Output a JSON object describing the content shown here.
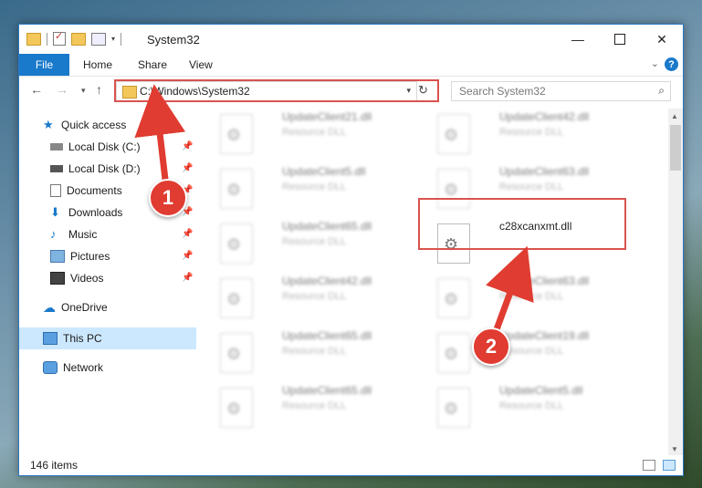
{
  "window": {
    "title": "System32",
    "minimize": "—",
    "close": "✕"
  },
  "ribbon": {
    "tabs": [
      "File",
      "Home",
      "Share",
      "View"
    ],
    "help": "?"
  },
  "address": {
    "path": "C:\\Windows\\System32",
    "search_placeholder": "Search System32"
  },
  "navpane": {
    "quick_access": "Quick access",
    "items": [
      "Local Disk (C:)",
      "Local Disk (D:)",
      "Documents",
      "Downloads",
      "Music",
      "Pictures",
      "Videos"
    ],
    "onedrive": "OneDrive",
    "this_pc": "This PC",
    "network": "Network"
  },
  "files": [
    {
      "name": "UpdateClient21.dll",
      "type": "Resource DLL"
    },
    {
      "name": "UpdateClient42.dll",
      "type": "Resource DLL"
    },
    {
      "name": "UpdateClient5.dll",
      "type": "Resource DLL"
    },
    {
      "name": "UpdateClient63.dll",
      "type": "Resource DLL"
    },
    {
      "name": "UpdateClient65.dll",
      "type": "Resource DLL"
    },
    {
      "name": "c28xcanxmt.dll",
      "type": ""
    },
    {
      "name": "UpdateClient42.dll",
      "type": "Resource DLL"
    },
    {
      "name": "UpdateClient63.dll",
      "type": "Resource DLL"
    },
    {
      "name": "UpdateClient65.dll",
      "type": "Resource DLL"
    },
    {
      "name": "UpdateClient19.dll",
      "type": "Resource DLL"
    },
    {
      "name": "UpdateClient65.dll",
      "type": "Resource DLL"
    },
    {
      "name": "UpdateClient5.dll",
      "type": "Resource DLL"
    }
  ],
  "status": {
    "count": "146 items"
  },
  "annotations": {
    "step1": "1",
    "step2": "2",
    "color": "#e03c31"
  }
}
